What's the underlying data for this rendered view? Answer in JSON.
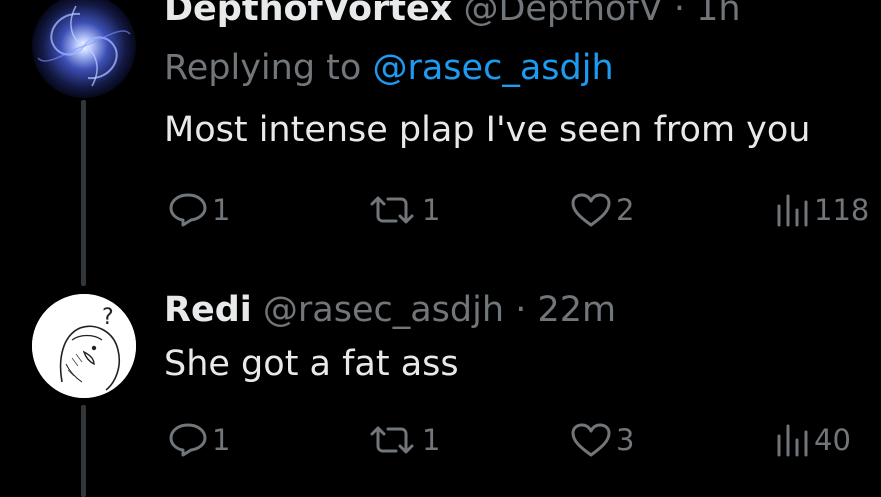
{
  "tweets": [
    {
      "display_name": "DepthofVortex",
      "handle": "@DepthofV",
      "separator": "·",
      "time": "1h",
      "replying_prefix": "Replying to",
      "replying_handle": "@rasec_asdjh",
      "text": "Most intense plap I've seen from you",
      "actions": {
        "replies": "1",
        "reposts": "1",
        "likes": "2",
        "views": "118"
      }
    },
    {
      "display_name": "Redi",
      "handle": "@rasec_asdjh",
      "separator": "·",
      "time": "22m",
      "text": "She got a fat ass",
      "avatar_badge": "?",
      "actions": {
        "replies": "1",
        "reposts": "1",
        "likes": "3",
        "views": "40"
      }
    }
  ],
  "colors": {
    "background": "#000000",
    "primary_text": "#e7e9ea",
    "secondary_text": "#71767b",
    "mention": "#1d9bf0",
    "thread_line": "#333639"
  },
  "icons": {
    "reply": "speech-bubble-icon",
    "repost": "repost-arrows-icon",
    "like": "heart-icon",
    "views": "bar-chart-icon"
  }
}
